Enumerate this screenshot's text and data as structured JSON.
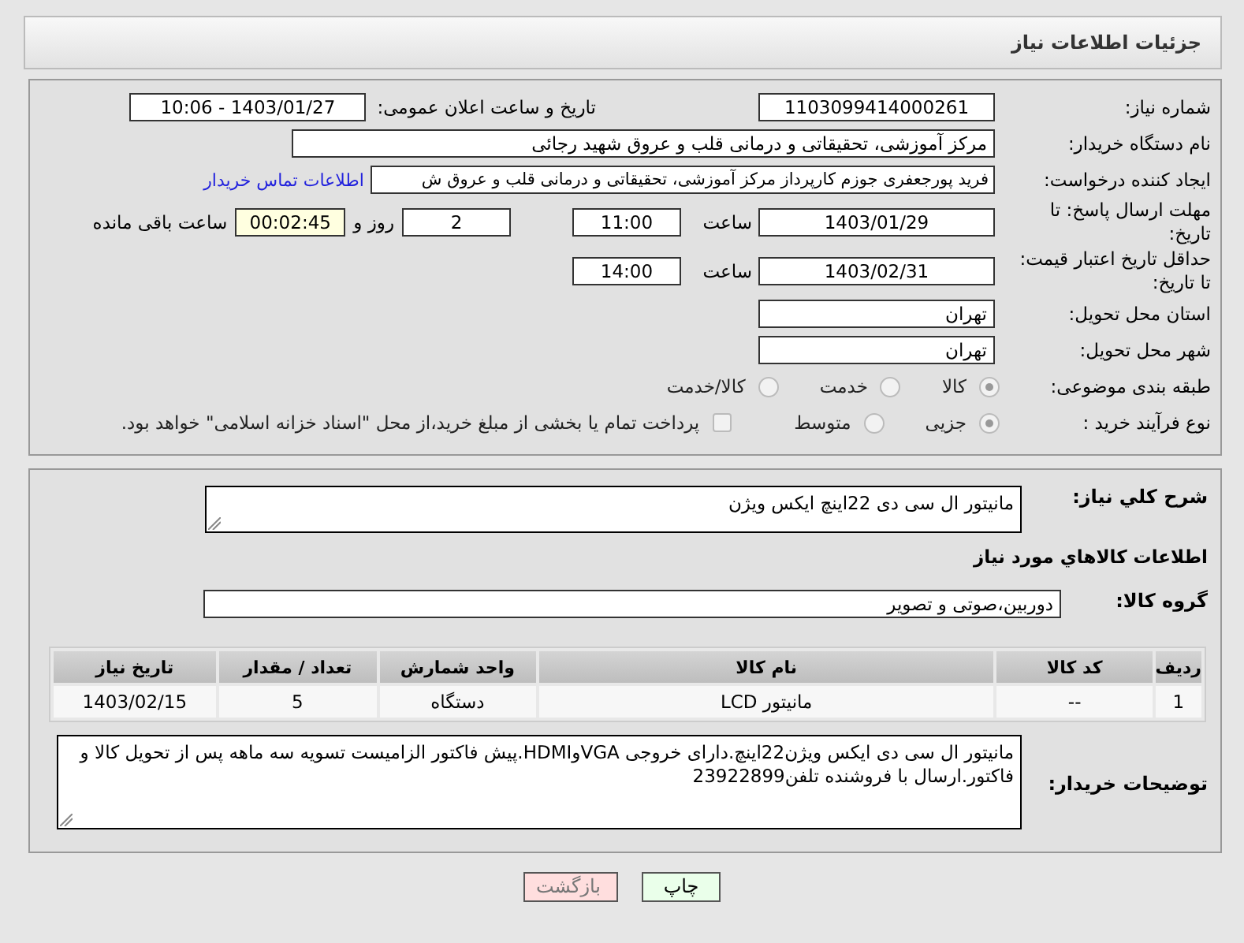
{
  "header": {
    "title": "جزئیات اطلاعات نیاز"
  },
  "details": {
    "need_number": {
      "label": "شماره نیاز:",
      "value": "1103099414000261"
    },
    "announce": {
      "label": "تاریخ و ساعت اعلان عمومی:",
      "value": "1403/01/27 - 10:06"
    },
    "buyer_org": {
      "label": "نام دستگاه خریدار:",
      "value": "مرکز آموزشی، تحقیقاتی و درمانی قلب و عروق شهید رجائی"
    },
    "creator": {
      "label": "ایجاد کننده درخواست:",
      "value": "فرید پورجعفری جوزم کارپرداز  مرکز آموزشی، تحقیقاتی و درمانی قلب و عروق ش",
      "link": "اطلاعات تماس خریدار"
    },
    "reply_deadline": {
      "label": "مهلت ارسال پاسخ: تا تاریخ:",
      "date": "1403/01/29",
      "time_label": "ساعت",
      "time": "11:00",
      "days": "2",
      "days_label": "روز و",
      "remaining": "00:02:45",
      "remaining_label": "ساعت باقی مانده"
    },
    "price_validity": {
      "label": "حداقل تاریخ اعتبار قیمت: تا تاریخ:",
      "date": "1403/02/31",
      "time_label": "ساعت",
      "time": "14:00"
    },
    "province": {
      "label": "استان محل تحویل:",
      "value": "تهران"
    },
    "city": {
      "label": "شهر محل تحویل:",
      "value": "تهران"
    },
    "category": {
      "label": "طبقه بندی موضوعی:",
      "options": [
        {
          "label": "کالا",
          "selected": true
        },
        {
          "label": "خدمت",
          "selected": false
        },
        {
          "label": "کالا/خدمت",
          "selected": false
        }
      ]
    },
    "purchase_type": {
      "label": "نوع فرآیند خرید :",
      "options": [
        {
          "label": "جزیی",
          "selected": true
        },
        {
          "label": "متوسط",
          "selected": false
        }
      ],
      "treasury": {
        "label": "پرداخت تمام یا بخشی از مبلغ خرید،از محل \"اسناد خزانه اسلامی\" خواهد بود.",
        "checked": false
      }
    }
  },
  "need": {
    "summary": {
      "label": "شرح كلي نياز:",
      "value": "مانیتور ال سی دی 22اینچ ایکس ویژن"
    },
    "goods_heading": "اطلاعات كالاهاي مورد نياز",
    "goods_group": {
      "label": "گروه کالا:",
      "value": "دوربین،صوتی و تصویر"
    },
    "table": {
      "columns": [
        "ردیف",
        "کد کالا",
        "نام کالا",
        "واحد شمارش",
        "تعداد / مقدار",
        "تاریخ نیاز"
      ],
      "rows": [
        [
          "1",
          "--",
          "مانیتور LCD",
          "دستگاه",
          "5",
          "1403/02/15"
        ]
      ]
    },
    "buyer_notes": {
      "label": "توضیحات خریدار:",
      "value": "مانیتور ال سی دی ایکس ویژن22اینچ.دارای خروجی VGAوHDMI.پیش فاکتور الزامیست تسویه سه ماهه پس از تحویل کالا و فاکتور.ارسال با فروشنده تلفن23922899"
    }
  },
  "buttons": [
    {
      "label": "چاپ",
      "kind": "print"
    },
    {
      "label": "بازگشت",
      "kind": "back"
    }
  ]
}
